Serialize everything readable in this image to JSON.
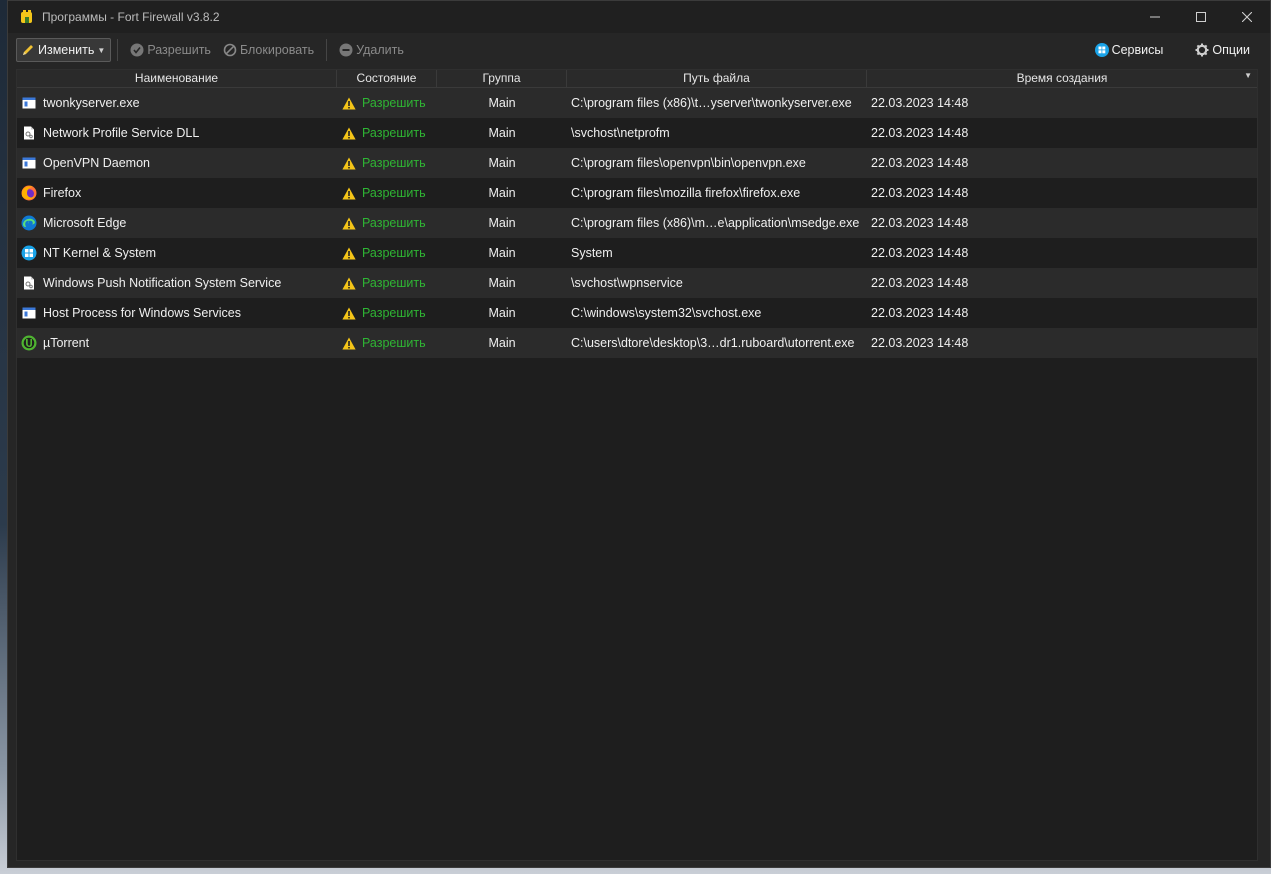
{
  "window": {
    "title": "Программы - Fort Firewall v3.8.2"
  },
  "toolbar": {
    "edit_label": "Изменить",
    "allow_label": "Разрешить",
    "block_label": "Блокировать",
    "delete_label": "Удалить",
    "services_label": "Сервисы",
    "options_label": "Опции"
  },
  "table": {
    "columns": [
      "Наименование",
      "Состояние",
      "Группа",
      "Путь файла",
      "Время создания"
    ],
    "rows": [
      {
        "name": "twonkyserver.exe",
        "icon": "exe-window-icon",
        "state": "Разрешить",
        "group": "Main",
        "path": "C:\\program files (x86)\\t…yserver\\twonkyserver.exe",
        "time": "22.03.2023 14:48"
      },
      {
        "name": "Network Profile Service DLL",
        "icon": "dll-file-icon",
        "state": "Разрешить",
        "group": "Main",
        "path": "\\svchost\\netprofm",
        "time": "22.03.2023 14:48"
      },
      {
        "name": "OpenVPN Daemon",
        "icon": "exe-window-icon",
        "state": "Разрешить",
        "group": "Main",
        "path": "C:\\program files\\openvpn\\bin\\openvpn.exe",
        "time": "22.03.2023 14:48"
      },
      {
        "name": "Firefox",
        "icon": "firefox-icon",
        "state": "Разрешить",
        "group": "Main",
        "path": "C:\\program files\\mozilla firefox\\firefox.exe",
        "time": "22.03.2023 14:48"
      },
      {
        "name": "Microsoft Edge",
        "icon": "edge-icon",
        "state": "Разрешить",
        "group": "Main",
        "path": "C:\\program files (x86)\\m…e\\application\\msedge.exe",
        "time": "22.03.2023 14:48"
      },
      {
        "name": "NT Kernel & System",
        "icon": "windows-logo-icon",
        "state": "Разрешить",
        "group": "Main",
        "path": "System",
        "time": "22.03.2023 14:48"
      },
      {
        "name": "Windows Push Notification System Service",
        "icon": "dll-file-icon",
        "state": "Разрешить",
        "group": "Main",
        "path": "\\svchost\\wpnservice",
        "time": "22.03.2023 14:48"
      },
      {
        "name": "Host Process for Windows Services",
        "icon": "exe-window-icon",
        "state": "Разрешить",
        "group": "Main",
        "path": "C:\\windows\\system32\\svchost.exe",
        "time": "22.03.2023 14:48"
      },
      {
        "name": "µTorrent",
        "icon": "utorrent-icon",
        "state": "Разрешить",
        "group": "Main",
        "path": "C:\\users\\dtore\\desktop\\3…dr1.ruboard\\utorrent.exe",
        "time": "22.03.2023 14:48"
      }
    ]
  },
  "colors": {
    "allowed_state": "#2fb534",
    "warning": "#f5c518"
  }
}
